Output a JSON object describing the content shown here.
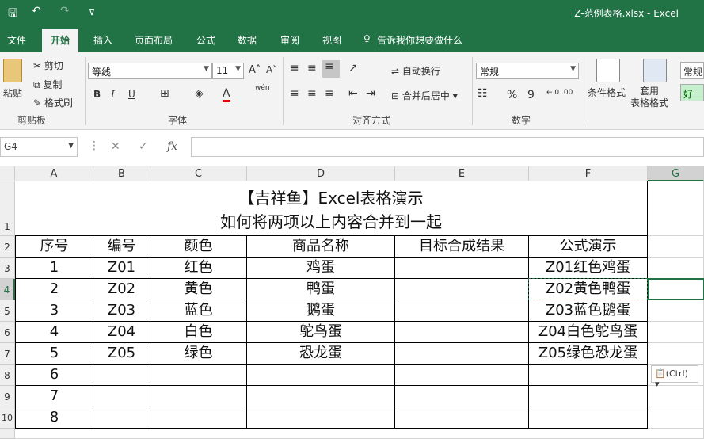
{
  "window": {
    "title": "Z-范例表格.xlsx  -  Excel"
  },
  "quick_access": {
    "save": "🖫",
    "undo": "↶",
    "redo": "↷",
    "more": "⊽"
  },
  "menu": [
    "文件",
    "开始",
    "插入",
    "页面布局",
    "公式",
    "数据",
    "审阅",
    "视图"
  ],
  "tell_me": "告诉我你想要做什么",
  "ribbon": {
    "clipboard": {
      "paste": "粘贴",
      "cut": "剪切",
      "copy": "复制",
      "format_painter": "格式刷",
      "group": "剪贴板"
    },
    "font": {
      "name": "等线",
      "size": "11",
      "grow": "A˄",
      "shrink": "A˅",
      "bold": "B",
      "italic": "I",
      "underline": "U",
      "wen": "wén",
      "group": "字体"
    },
    "alignment": {
      "wrap": "自动换行",
      "merge": "合并后居中",
      "group": "对齐方式"
    },
    "number": {
      "format": "常规",
      "percent": "%",
      "comma": "9",
      "inc": "←.0 .00",
      "group": "数字"
    },
    "styles": {
      "conditional": "条件格式",
      "table": "套用\n表格格式",
      "normal": "常规",
      "good": "好"
    }
  },
  "formula_bar": {
    "name_box": "G4",
    "cancel": "✕",
    "enter": "✓",
    "fx": "fx",
    "value": ""
  },
  "columns": [
    "A",
    "B",
    "C",
    "D",
    "E",
    "F",
    "G"
  ],
  "rows": [
    "1",
    "2",
    "3",
    "4",
    "5",
    "6",
    "7",
    "8",
    "9",
    "10"
  ],
  "sheet": {
    "title_line1": "【吉祥鱼】Excel表格演示",
    "title_line2": "如何将两项以上内容合并到一起",
    "headers": [
      "序号",
      "编号",
      "颜色",
      "商品名称",
      "目标合成结果",
      "公式演示"
    ],
    "data": [
      [
        "1",
        "Z01",
        "红色",
        "鸡蛋",
        "",
        "Z01红色鸡蛋"
      ],
      [
        "2",
        "Z02",
        "黄色",
        "鸭蛋",
        "",
        "Z02黄色鸭蛋"
      ],
      [
        "3",
        "Z03",
        "蓝色",
        "鹅蛋",
        "",
        "Z03蓝色鹅蛋"
      ],
      [
        "4",
        "Z04",
        "白色",
        "鸵鸟蛋",
        "",
        "Z04白色鸵鸟蛋"
      ],
      [
        "5",
        "Z05",
        "绿色",
        "恐龙蛋",
        "",
        "Z05绿色恐龙蛋"
      ],
      [
        "6",
        "",
        "",
        "",
        "",
        ""
      ],
      [
        "7",
        "",
        "",
        "",
        "",
        ""
      ],
      [
        "8",
        "",
        "",
        "",
        "",
        ""
      ]
    ]
  },
  "paste_options": "(Ctrl)",
  "colors": {
    "accent": "#217346",
    "selection": "#217346"
  }
}
